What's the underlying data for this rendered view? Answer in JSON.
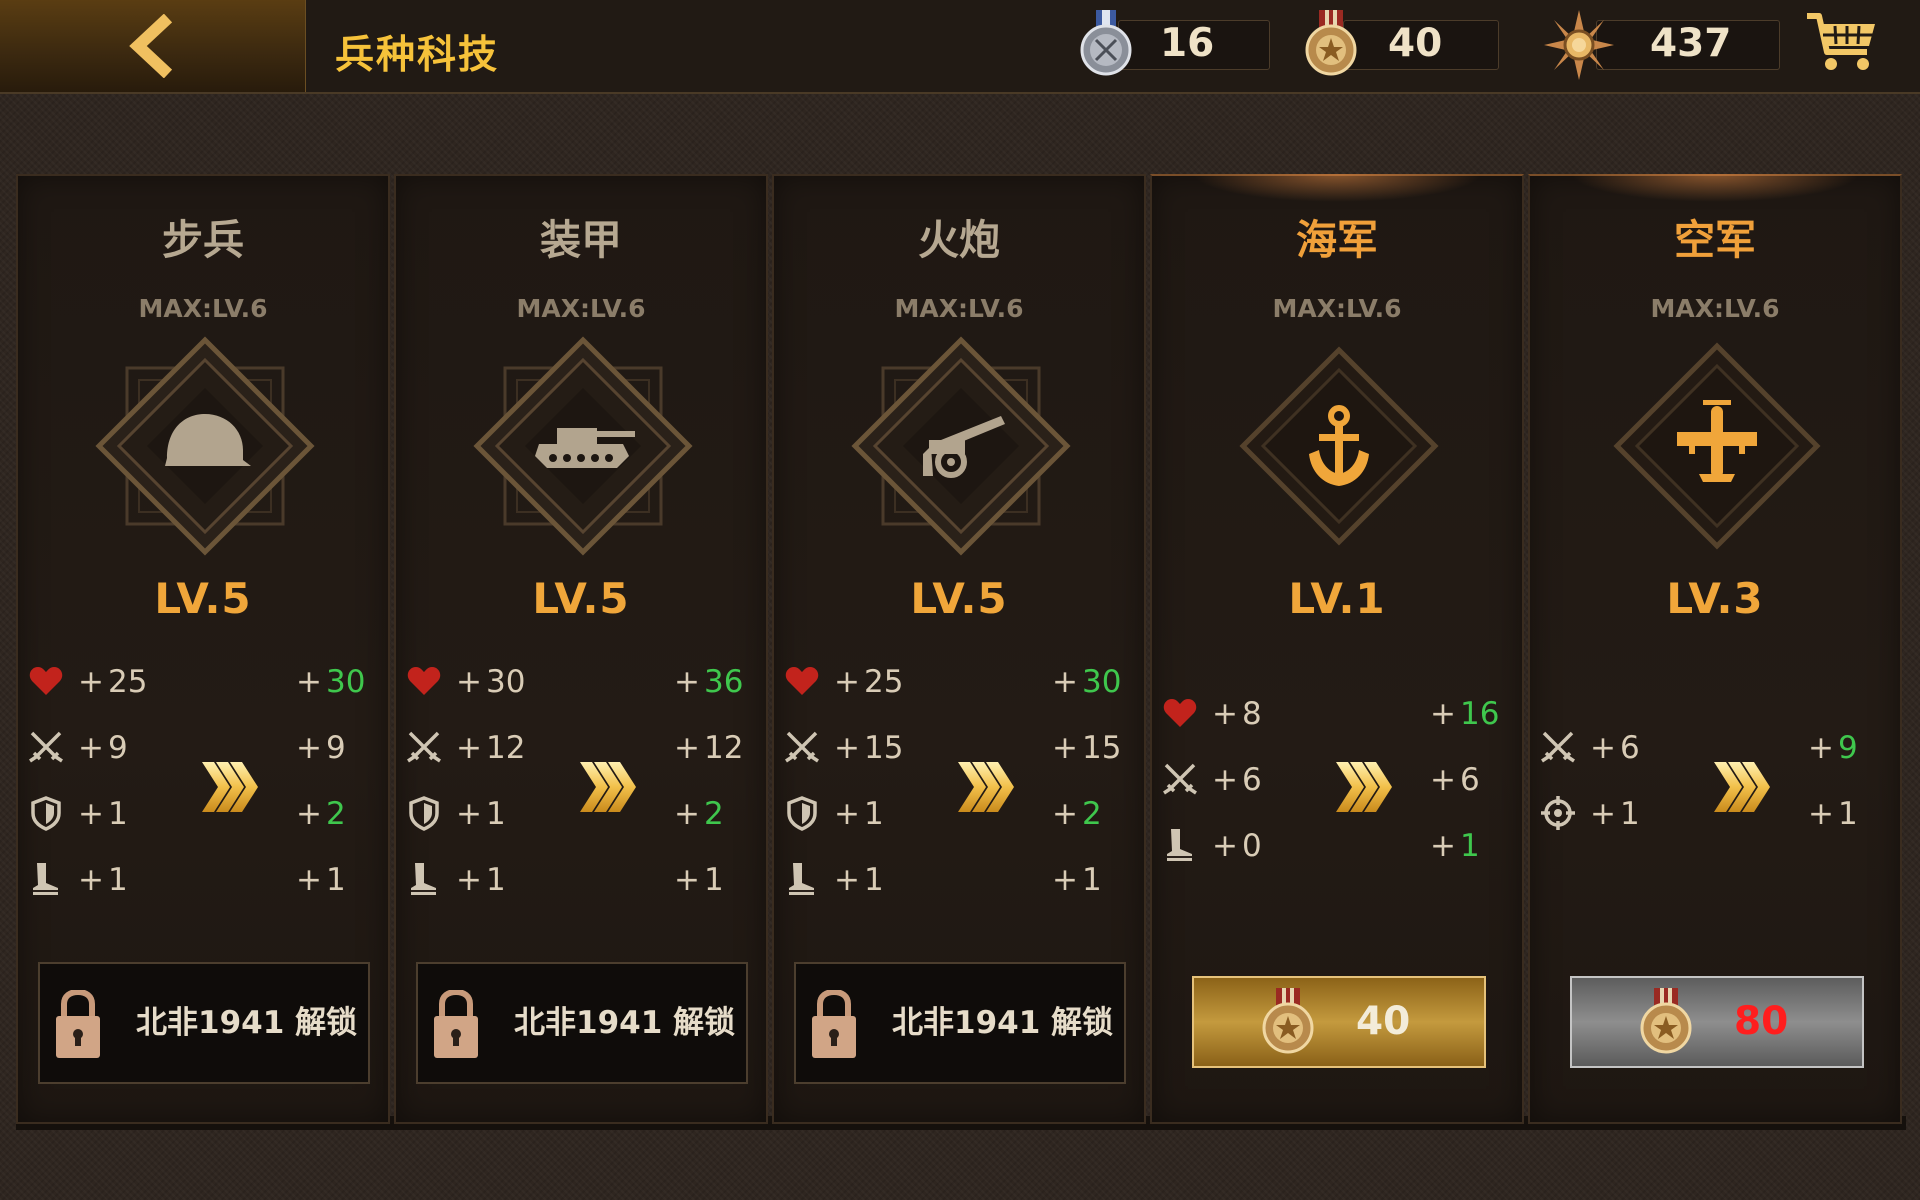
{
  "header": {
    "title": "兵种科技",
    "resources": [
      {
        "name": "silver-medal",
        "value": "16"
      },
      {
        "name": "bronze-medal",
        "value": "40"
      },
      {
        "name": "star-badge",
        "value": "437"
      }
    ]
  },
  "colors": {
    "accent": "#f0a63a",
    "title": "#f6c23a",
    "green": "#3fc74d",
    "red": "#ff1e1e"
  },
  "branches": [
    {
      "name": "步兵",
      "max": "MAX:LV.6",
      "level": "LV.5",
      "icon": "helmet-icon",
      "active": false,
      "stats": [
        {
          "icon": "heart-icon",
          "cur": "25",
          "next": "30",
          "up": true
        },
        {
          "icon": "swords-icon",
          "cur": "9",
          "next": "9",
          "up": false
        },
        {
          "icon": "shield-icon",
          "cur": "1",
          "next": "2",
          "up": true
        },
        {
          "icon": "boot-icon",
          "cur": "1",
          "next": "1",
          "up": false
        }
      ],
      "button": {
        "type": "lock",
        "label": "北非1941 解锁"
      }
    },
    {
      "name": "装甲",
      "max": "MAX:LV.6",
      "level": "LV.5",
      "icon": "tank-icon",
      "active": false,
      "stats": [
        {
          "icon": "heart-icon",
          "cur": "30",
          "next": "36",
          "up": true
        },
        {
          "icon": "swords-icon",
          "cur": "12",
          "next": "12",
          "up": false
        },
        {
          "icon": "shield-icon",
          "cur": "1",
          "next": "2",
          "up": true
        },
        {
          "icon": "boot-icon",
          "cur": "1",
          "next": "1",
          "up": false
        }
      ],
      "button": {
        "type": "lock",
        "label": "北非1941 解锁"
      }
    },
    {
      "name": "火炮",
      "max": "MAX:LV.6",
      "level": "LV.5",
      "icon": "cannon-icon",
      "active": false,
      "stats": [
        {
          "icon": "heart-icon",
          "cur": "25",
          "next": "30",
          "up": true
        },
        {
          "icon": "swords-icon",
          "cur": "15",
          "next": "15",
          "up": false
        },
        {
          "icon": "shield-icon",
          "cur": "1",
          "next": "2",
          "up": true
        },
        {
          "icon": "boot-icon",
          "cur": "1",
          "next": "1",
          "up": false
        }
      ],
      "button": {
        "type": "lock",
        "label": "北非1941 解锁"
      }
    },
    {
      "name": "海军",
      "max": "MAX:LV.6",
      "level": "LV.1",
      "icon": "anchor-icon",
      "active": true,
      "stats": [
        {
          "icon": "heart-icon",
          "cur": "8",
          "next": "16",
          "up": true
        },
        {
          "icon": "swords-icon",
          "cur": "6",
          "next": "6",
          "up": false
        },
        {
          "icon": "boot-icon",
          "cur": "0",
          "next": "1",
          "up": true
        }
      ],
      "button": {
        "type": "buy",
        "price": "40",
        "style": "gold"
      }
    },
    {
      "name": "空军",
      "max": "MAX:LV.6",
      "level": "LV.3",
      "icon": "plane-icon",
      "active": true,
      "stats": [
        {
          "icon": "swords-icon",
          "cur": "6",
          "next": "9",
          "up": true
        },
        {
          "icon": "crosshair-icon",
          "cur": "1",
          "next": "1",
          "up": false
        }
      ],
      "button": {
        "type": "buy",
        "price": "80",
        "style": "grey"
      }
    }
  ]
}
